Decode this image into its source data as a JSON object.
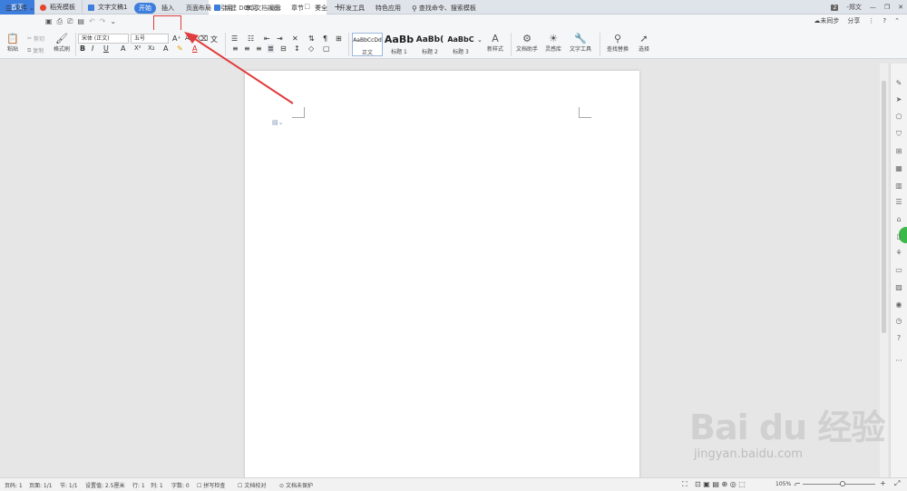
{
  "tabs": [
    {
      "label": "首页",
      "color": "#3d7ddc"
    },
    {
      "label": "稻壳模板",
      "color": "#e4452f"
    },
    {
      "label": "文字文稿1",
      "color": "#3d7ddc"
    },
    {
      "label": "新建 DOC 文档.doc",
      "color": "#3d7ddc"
    }
  ],
  "title_right": {
    "count": "2",
    "user": "-郑文"
  },
  "menu": {
    "file": "文件",
    "items": [
      "开始",
      "插入",
      "页面布局",
      "引用",
      "审阅",
      "视图",
      "章节",
      "安全",
      "开发工具",
      "特色应用"
    ],
    "search": "查找命令、搜索模板",
    "unsync": "未同步",
    "share": "分享"
  },
  "ribbon": {
    "paste": "粘贴",
    "cut": "剪切",
    "copy": "复制",
    "format_painter": "格式刷",
    "font_name": "宋体 (正文)",
    "font_size": "五号",
    "format_buttons": [
      "B",
      "I",
      "U",
      "A",
      "X²",
      "X₂",
      "A"
    ],
    "styles": [
      {
        "sample": "AaBbCcDd",
        "name": "正文"
      },
      {
        "sample": "AaBb",
        "name": "标题 1"
      },
      {
        "sample": "AaBb(",
        "name": "标题 2"
      },
      {
        "sample": "AaBbC",
        "name": "标题 3"
      }
    ],
    "new_style": "新样式",
    "doc_assistant": "文档助手",
    "inspiration": "灵感库",
    "text_tools": "文字工具",
    "find_replace": "查找替换",
    "select": "选择"
  },
  "status": {
    "page": "页码: 1",
    "pages": "页面: 1/1",
    "section": "节: 1/1",
    "setting": "设置值: 2.5厘米",
    "row": "行: 1",
    "col": "列: 1",
    "words": "字数: 0",
    "spell": "拼写检查",
    "proof": "文档校对",
    "protect": "文档未保护",
    "zoom": "105%"
  },
  "watermark": {
    "main": "Bai du 经验",
    "sub": "jingyan.baidu.com"
  },
  "colors": {
    "accent": "#3d7ddc",
    "highlight": "#e03c3c",
    "green": "#3cb84a"
  }
}
